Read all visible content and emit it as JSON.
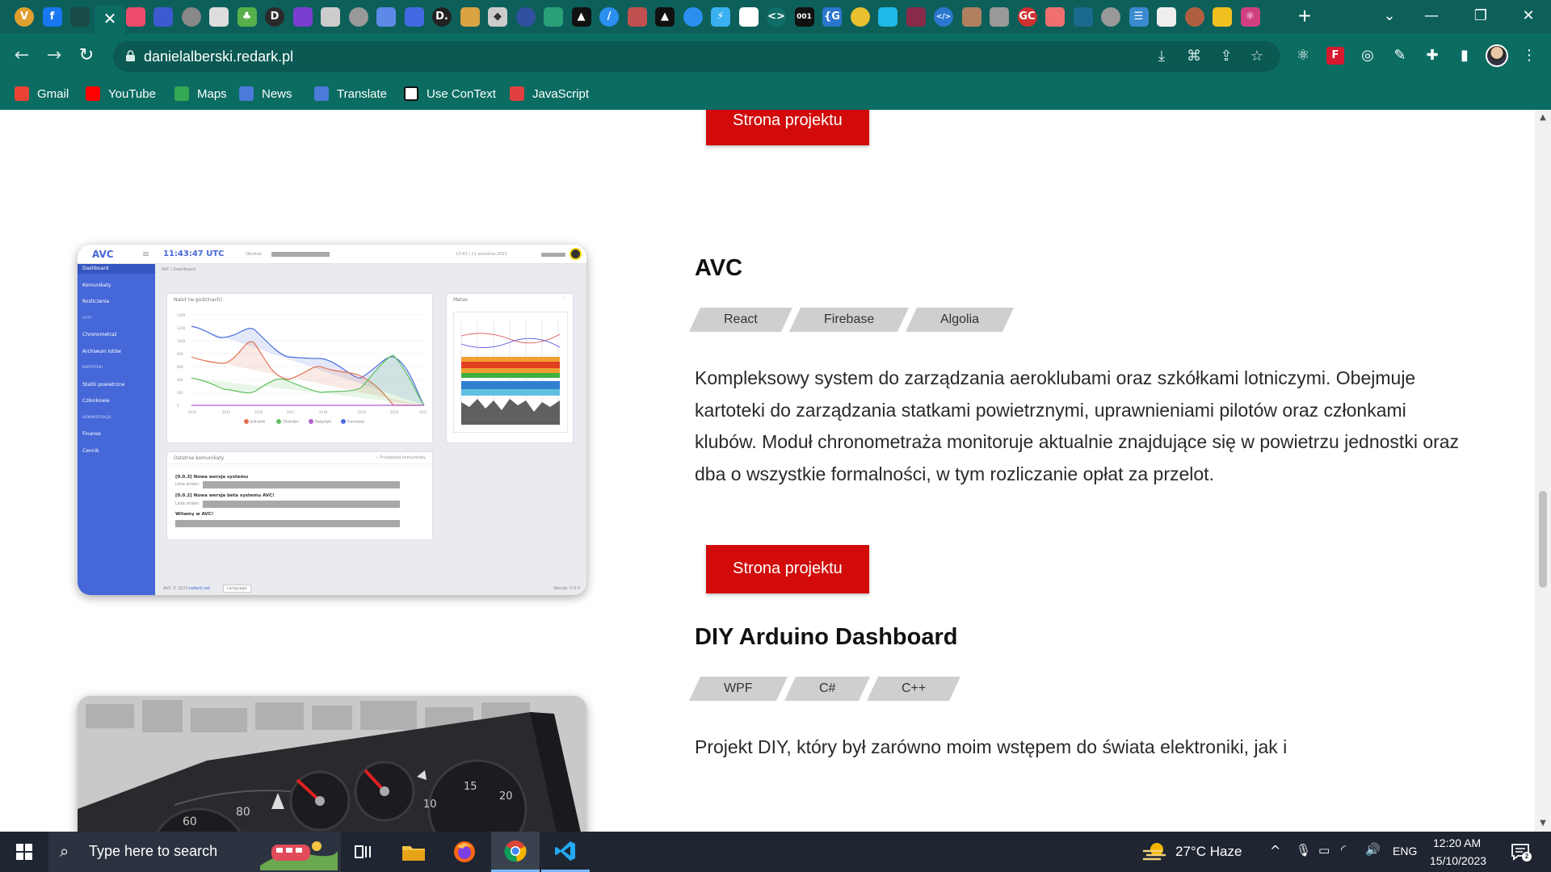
{
  "browser": {
    "url": "danielalberski.redark.pl",
    "tabs": [
      {
        "icon": "vivaldi-icon",
        "color": "#e0a030"
      },
      {
        "icon": "facebook-icon",
        "color": "#1877f2"
      },
      {
        "icon": "tab-icon-dark",
        "color": "#1a4a47"
      },
      {
        "icon": "close-icon",
        "color": "#0b6c62"
      },
      {
        "icon": "tab-icon-red-circle",
        "color": "#ef4c6c"
      },
      {
        "icon": "tab-icon-blue-square",
        "color": "#3d5ad0"
      },
      {
        "icon": "tab-icon-gear",
        "color": "#888888"
      },
      {
        "icon": "tab-icon-cloud",
        "color": "#dddddd"
      },
      {
        "icon": "tab-icon-clover",
        "color": "#57b04a"
      },
      {
        "icon": "tab-icon-d-dark",
        "color": "#2a2a2a"
      },
      {
        "icon": "tab-icon-purple",
        "color": "#7a3fd0"
      },
      {
        "icon": "tab-icon-globe",
        "color": "#cccccc"
      },
      {
        "icon": "tab-icon-globe-gray",
        "color": "#999999"
      },
      {
        "icon": "tab-icon-blue-doc",
        "color": "#5d8ae8"
      },
      {
        "icon": "tab-icon-blue-circle",
        "color": "#4169e1"
      },
      {
        "icon": "tab-icon-d-letter",
        "color": "#222222"
      },
      {
        "icon": "tab-icon-photo",
        "color": "#d9a441"
      },
      {
        "icon": "tab-icon-dots",
        "color": "#cccccc"
      },
      {
        "icon": "tab-icon-gear-blue",
        "color": "#3050a0"
      },
      {
        "icon": "tab-icon-frame",
        "color": "#2aa07a"
      },
      {
        "icon": "tab-icon-triangle",
        "color": "#111111"
      },
      {
        "icon": "tab-icon-slash",
        "color": "#2a8ff0"
      },
      {
        "icon": "tab-icon-figure",
        "color": "#c05050"
      },
      {
        "icon": "tab-icon-triangle-2",
        "color": "#111111"
      },
      {
        "icon": "tab-icon-ring",
        "color": "#2a8ff0"
      },
      {
        "icon": "tab-icon-bolt",
        "color": "#3ab0f0"
      },
      {
        "icon": "tab-icon-y",
        "color": "#ffffff"
      },
      {
        "icon": "tab-icon-code",
        "color": "#0f6f67"
      },
      {
        "icon": "tab-icon-001",
        "color": "#111111"
      },
      {
        "icon": "tab-icon-brace",
        "color": "#2b77d0"
      },
      {
        "icon": "tab-icon-chicken",
        "color": "#e8c030"
      },
      {
        "icon": "tab-icon-cyan",
        "color": "#20b8e8"
      },
      {
        "icon": "tab-icon-maroon",
        "color": "#8a2a4a"
      },
      {
        "icon": "tab-icon-vscode-web",
        "color": "#2b77d0"
      },
      {
        "icon": "tab-icon-portrait",
        "color": "#b08060"
      },
      {
        "icon": "tab-icon-globe-3",
        "color": "#999999"
      },
      {
        "icon": "tab-icon-gc",
        "color": "#d03030"
      },
      {
        "icon": "tab-icon-food",
        "color": "#f07070"
      },
      {
        "icon": "tab-icon-tree",
        "color": "#1a6a90"
      },
      {
        "icon": "tab-icon-globe-4",
        "color": "#999999"
      },
      {
        "icon": "tab-icon-stripes",
        "color": "#3a8ad0"
      },
      {
        "icon": "tab-icon-white-circle",
        "color": "#eeeeee"
      },
      {
        "icon": "tab-icon-face",
        "color": "#b06040"
      },
      {
        "icon": "tab-icon-yellow-figure",
        "color": "#f0c020"
      },
      {
        "icon": "tab-icon-atom",
        "color": "#d04080"
      }
    ],
    "bookmarks": [
      {
        "label": "Gmail",
        "color": "#ea4335"
      },
      {
        "label": "YouTube",
        "color": "#ff0000"
      },
      {
        "label": "Maps",
        "color": "#34a853"
      },
      {
        "label": "News",
        "color": "#4a7bd8"
      },
      {
        "label": "Translate",
        "color": "#4a7bd8"
      },
      {
        "label": "Use ConText",
        "color": "#ffffff"
      },
      {
        "label": "JavaScript",
        "color": "#e04040"
      }
    ]
  },
  "page": {
    "top_button": "Strona projektu",
    "projects": [
      {
        "title": "AVC",
        "tags": [
          "React",
          "Firebase",
          "Algolia"
        ],
        "description": "Kompleksowy system do zarządzania aeroklubami oraz szkółkami lotniczymi. Obejmuje kartoteki do zarządzania statkami powietrznymi, uprawnieniami pilotów oraz członkami klubów. Moduł chronometraża monitoruje aktualnie znajdujące się w powietrzu jednostki oraz dba o wszystkie formalności, w tym rozliczanie opłat za przelot.",
        "button": "Strona projektu"
      },
      {
        "title": "DIY Arduino Dashboard",
        "tags": [
          "WPF",
          "C#",
          "C++"
        ],
        "description": "Projekt DIY, który był zarówno moim wstępem do świata elektroniki, jak i"
      }
    ],
    "avc_screenshot": {
      "logo": "AVC",
      "clock": "11:43:47 UTC",
      "clock_sub": "Obrotek",
      "date": "13:43 | 21 września 2021",
      "breadcrumb": "AVC / Dashboard",
      "menu": [
        "Dashboard",
        "Komunikaty",
        "Rozliczenia",
        "LOTY",
        "Chronometraż",
        "Archiwum lotów",
        "KARTOTEKI",
        "Statki powietrzne",
        "Członkowie",
        "ADMINISTRACJA",
        "Finanse",
        "Cennik"
      ],
      "chart_title": "Nalot (w godzinach)",
      "meteo_title": "Metas",
      "news_title": "Ostatnie komunikaty",
      "news_search": "Przeglądaj komunikaty",
      "news": [
        {
          "title": "[0.0.3] Nowa wersja systemu",
          "line": "Lista zmian:"
        },
        {
          "title": "[0.0.2] Nowa wersja beta systemu AVC!",
          "line": "Lista zmian:"
        },
        {
          "title": "Witamy w AVC!",
          "line": ""
        }
      ],
      "footer_left": "AVC © 2020",
      "footer_link": "redark.net",
      "footer_lang": "Language",
      "footer_version": "Wersja: 0.0.4",
      "chart_years": [
        "2014",
        "2015",
        "2016",
        "2017",
        "2018",
        "2019",
        "2020",
        "2021"
      ],
      "chart_y_ticks": [
        "1400",
        "1200",
        "1000",
        "800",
        "600",
        "400",
        "200",
        "0"
      ],
      "chart_legend": [
        "Jednostki",
        "Chemilian",
        "Statystyki",
        "Franciszek"
      ],
      "chart_colors": [
        "#e07050",
        "#60c060",
        "#b060d0",
        "#4a6ce0"
      ]
    }
  },
  "taskbar": {
    "search_placeholder": "Type here to search",
    "weather": "27°C  Haze",
    "language": "ENG",
    "time": "12:20 AM",
    "date": "15/10/2023"
  }
}
